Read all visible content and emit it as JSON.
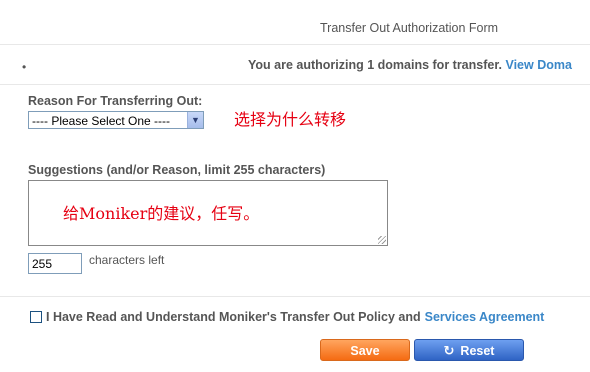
{
  "form": {
    "title": "Transfer Out Authorization Form",
    "bullet": "•",
    "authorizing_prefix": "You are authorizing 1 domains for transfer.",
    "view_domains_link": "View Doma"
  },
  "reason": {
    "label": "Reason For Transferring Out:",
    "selected_option": "---- Please Select One ----",
    "annotation": "选择为什么转移"
  },
  "suggestions": {
    "label": "Suggestions (and/or Reason, limit 255 characters)",
    "annotation": "给Moniker的建议，任写。",
    "counter_value": "255",
    "counter_suffix": "characters left"
  },
  "agreement": {
    "text": "I Have Read and Understand Moniker's Transfer Out Policy and",
    "link": "Services Agreement"
  },
  "buttons": {
    "save": "Save",
    "reset": "Reset"
  },
  "colors": {
    "link": "#3a87c8",
    "annotation_red": "#e60012",
    "save_orange": "#f56b12",
    "reset_blue": "#2f63c4"
  }
}
